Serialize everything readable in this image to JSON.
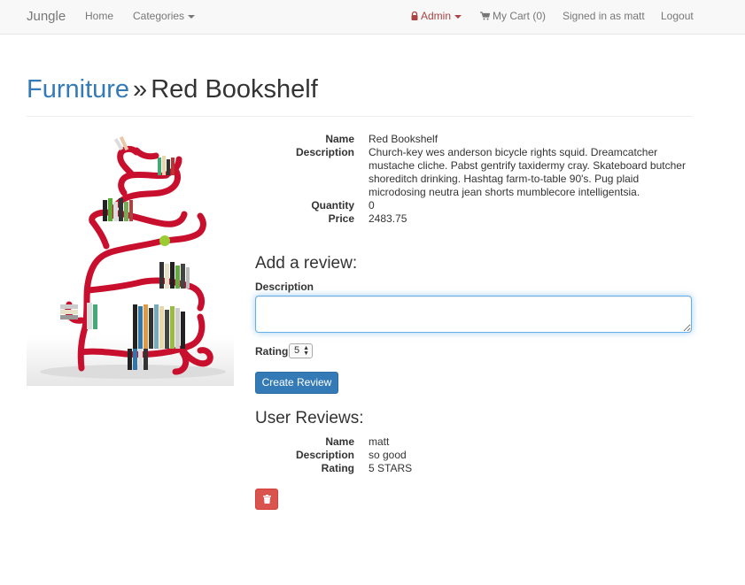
{
  "navbar": {
    "brand": "Jungle",
    "home": "Home",
    "categories": "Categories",
    "admin": "Admin",
    "cart": "My Cart (0)",
    "signed_in": "Signed in as matt",
    "logout": "Logout"
  },
  "header": {
    "category": "Furniture",
    "separator": "»",
    "product_name": "Red Bookshelf"
  },
  "product": {
    "name_label": "Name",
    "name": "Red Bookshelf",
    "description_label": "Description",
    "description": "Church-key wes anderson bicycle rights squid. Dreamcatcher mustache cliche. Pabst gentrify taxidermy cray. Skateboard butcher shoreditch drinking. Hashtag farm-to-table 90's. Pug plaid microdosing neutra jean shorts mumblecore intelligentsia.",
    "quantity_label": "Quantity",
    "quantity": "0",
    "price_label": "Price",
    "price": "2483.75"
  },
  "review_form": {
    "heading": "Add a review:",
    "description_label": "Description",
    "description_value": "",
    "rating_label": "Rating",
    "rating_value": "5",
    "submit": "Create Review"
  },
  "user_reviews": {
    "heading": "User Reviews:",
    "items": [
      {
        "name_label": "Name",
        "name": "matt",
        "description_label": "Description",
        "description": "so good",
        "rating_label": "Rating",
        "rating": "5 STARS"
      }
    ]
  },
  "colors": {
    "link": "#337ab7",
    "admin": "#a94442",
    "primary": "#337ab7",
    "danger": "#d9534f",
    "shelf_red": "#c8102e"
  },
  "icons": {
    "admin": "lock-icon",
    "cart": "shopping-cart-icon",
    "delete": "trash-icon"
  }
}
